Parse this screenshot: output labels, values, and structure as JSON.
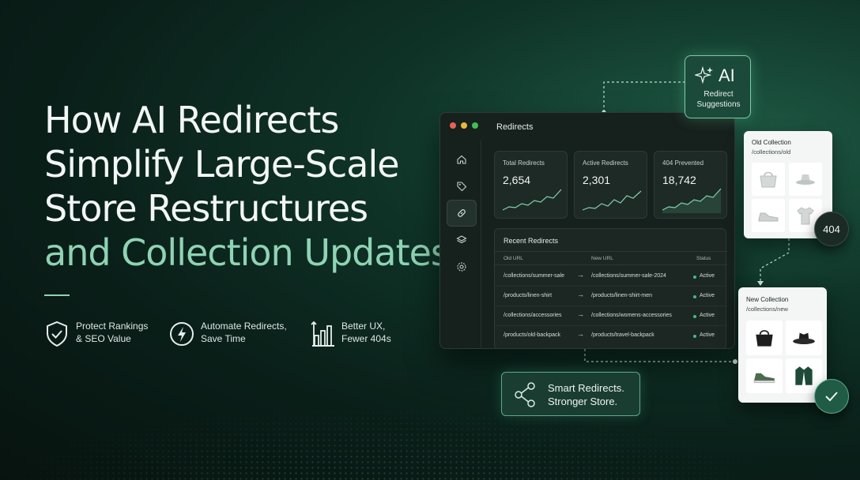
{
  "headline": {
    "line1": "How AI Redirects",
    "line2": "Simplify Large-Scale",
    "line3": "Store Restructures",
    "line4": "and Collection Updates"
  },
  "features": [
    {
      "icon": "shield-check-icon",
      "text": "Protect Rankings\n& SEO Value"
    },
    {
      "icon": "lightning-icon",
      "text": "Automate Redirects,\nSave Time"
    },
    {
      "icon": "bar-chart-icon",
      "text": "Better UX,\nFewer 404s"
    }
  ],
  "window": {
    "title": "Redirects",
    "sidebar_icons": [
      "home-icon",
      "tag-icon",
      "link-icon",
      "layers-icon",
      "settings-icon"
    ],
    "stats": [
      {
        "label": "Total Redirects",
        "value": "2,654"
      },
      {
        "label": "Active Redirects",
        "value": "2,301"
      },
      {
        "label": "404 Prevented",
        "value": "18,742"
      }
    ],
    "recent": {
      "title": "Recent Redirects",
      "columns": [
        "Old URL",
        "New URL",
        "Status"
      ],
      "rows": [
        {
          "old": "/collections/summer-sale",
          "new": "/collections/summer-sale-2024",
          "status": "Active"
        },
        {
          "old": "/products/linen-shirt",
          "new": "/products/linen-shirt-men",
          "status": "Active"
        },
        {
          "old": "/collections/accessories",
          "new": "/collections/womens-accessories",
          "status": "Active"
        },
        {
          "old": "/products/old-backpack",
          "new": "/products/travel-backpack",
          "status": "Active"
        }
      ]
    }
  },
  "ai_card": {
    "title": "AI",
    "subtitle": "Redirect\nSuggestions"
  },
  "old_collection": {
    "title": "Old Collection",
    "path": "/collections/old"
  },
  "new_collection": {
    "title": "New Collection",
    "path": "/collections/new"
  },
  "badge_404": "404",
  "smart_card": {
    "text": "Smart Redirects.\nStronger Store."
  },
  "colors": {
    "accent": "#8fd3b4",
    "active_dot": "#3ec07e",
    "background": "#0a1f19"
  }
}
